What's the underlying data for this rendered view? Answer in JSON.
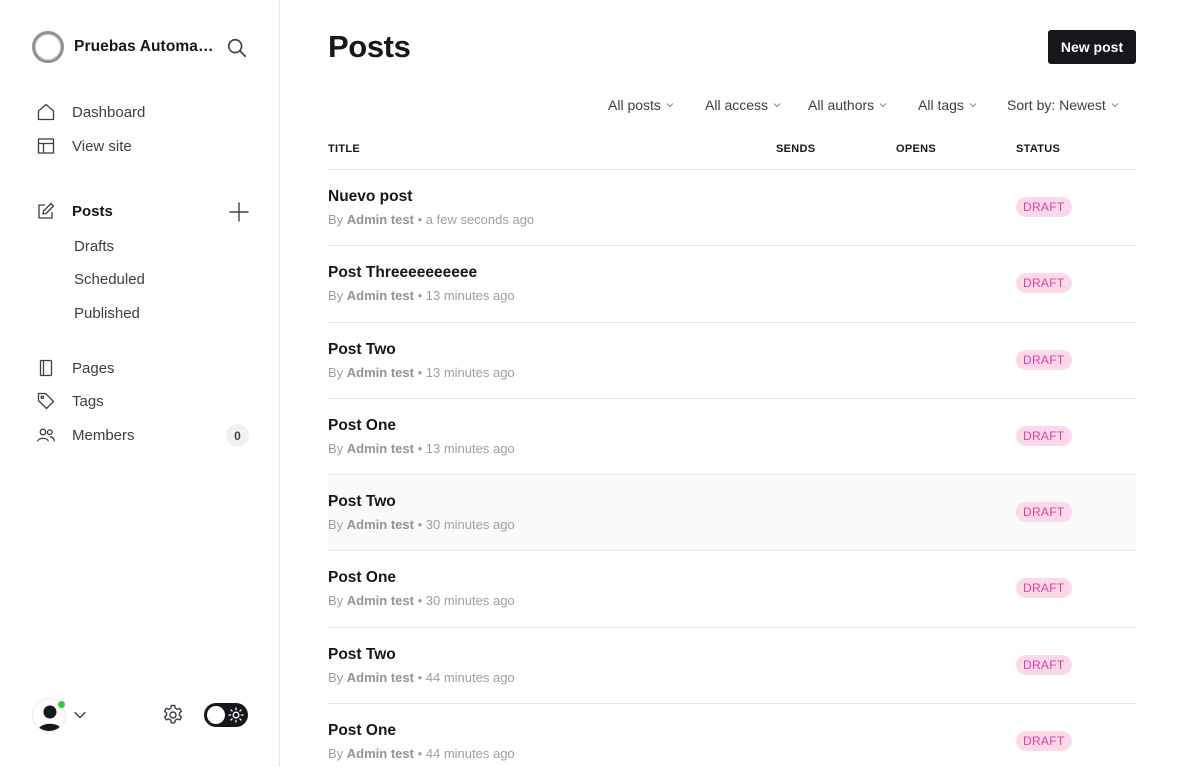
{
  "sidebar": {
    "site_name": "Pruebas Automatizadas",
    "nav": {
      "dashboard": "Dashboard",
      "view_site": "View site",
      "posts": "Posts",
      "drafts": "Drafts",
      "scheduled": "Scheduled",
      "published": "Published",
      "pages": "Pages",
      "tags": "Tags",
      "members": "Members",
      "members_count": "0"
    },
    "footer": {
      "status_color": "#30cf43",
      "theme": "dark-toggle"
    }
  },
  "main": {
    "title": "Posts",
    "new_post_label": "New post",
    "filters": {
      "type": "All posts",
      "access": "All access",
      "authors": "All authors",
      "tags": "All tags",
      "sort": "Sort by: Newest"
    },
    "columns": {
      "title": "TITLE",
      "sends": "SENDS",
      "opens": "OPENS",
      "status": "STATUS"
    },
    "posts": [
      {
        "title": "Nuevo post",
        "by": "By",
        "author": "Admin test",
        "time": "• a few seconds ago",
        "status": "DRAFT"
      },
      {
        "title": "Post Threeeeeeeeee",
        "by": "By",
        "author": "Admin test",
        "time": "• 13 minutes ago",
        "status": "DRAFT"
      },
      {
        "title": "Post Two",
        "by": "By",
        "author": "Admin test",
        "time": "• 13 minutes ago",
        "status": "DRAFT"
      },
      {
        "title": "Post One",
        "by": "By",
        "author": "Admin test",
        "time": "• 13 minutes ago",
        "status": "DRAFT"
      },
      {
        "title": "Post Two",
        "by": "By",
        "author": "Admin test",
        "time": "• 30 minutes ago",
        "status": "DRAFT"
      },
      {
        "title": "Post One",
        "by": "By",
        "author": "Admin test",
        "time": "• 30 minutes ago",
        "status": "DRAFT"
      },
      {
        "title": "Post Two",
        "by": "By",
        "author": "Admin test",
        "time": "• 44 minutes ago",
        "status": "DRAFT"
      },
      {
        "title": "Post One",
        "by": "By",
        "author": "Admin test",
        "time": "• 44 minutes ago",
        "status": "DRAFT"
      }
    ]
  },
  "colors": {
    "accent_dark": "#15171a",
    "draft_badge_bg": "#fbd9ea",
    "draft_badge_text": "#e33da1"
  }
}
